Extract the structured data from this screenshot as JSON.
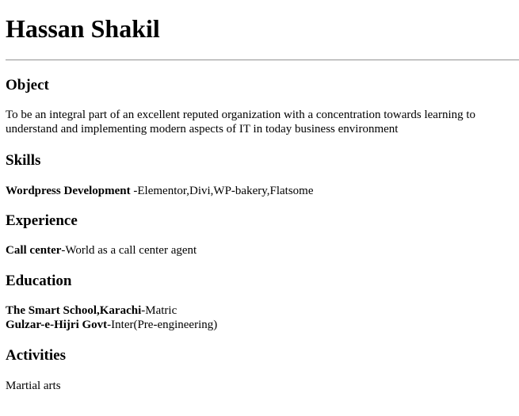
{
  "name": "Hassan Shakil",
  "object": {
    "heading": "Object",
    "text": "To be an integral part of an excellent reputed organization with a concentration towards learning to understand and implementing modern aspects of IT in today business environment"
  },
  "skills": {
    "heading": "Skills",
    "title": "Wordpress Development",
    "detail": " -Elementor,Divi,WP-bakery,Flatsome"
  },
  "experience": {
    "heading": "Experience",
    "title": "Call center",
    "detail": "-World as a call center agent"
  },
  "education": {
    "heading": "Education",
    "entries": [
      {
        "school": "The Smart School,Karachi",
        "detail": "-Matric"
      },
      {
        "school": "Gulzar-e-Hijri Govt",
        "detail": "-Inter(Pre-engineering)"
      }
    ]
  },
  "activities": {
    "heading": "Activities",
    "text": "Martial arts"
  }
}
